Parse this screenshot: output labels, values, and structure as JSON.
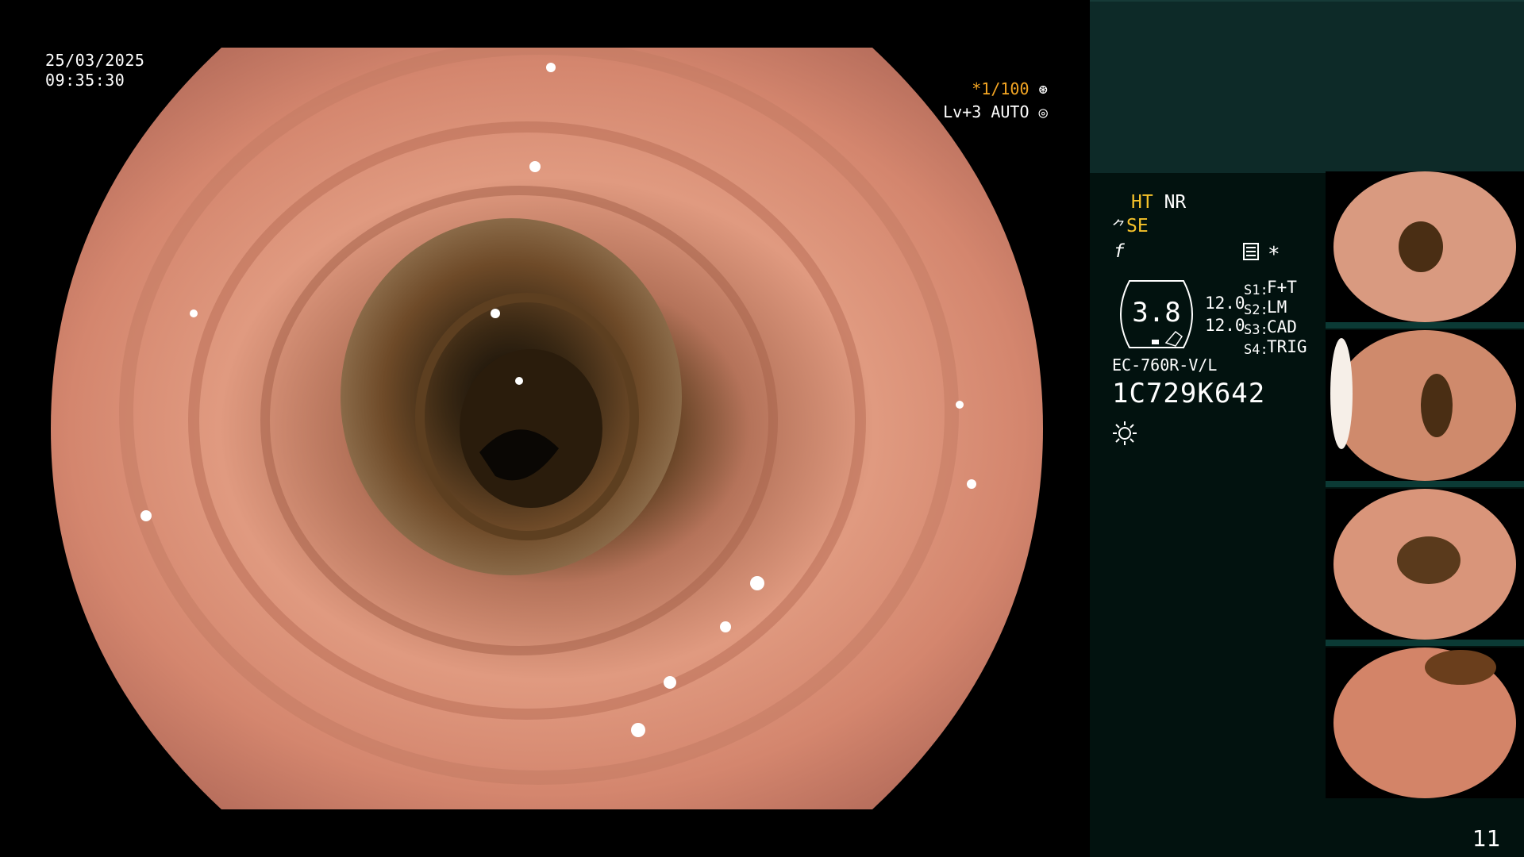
{
  "overlay": {
    "date": "25/03/2025",
    "time": "09:35:30",
    "shutter_speed": "*1/100",
    "shutter_icon": "aperture-icon",
    "level": "Lv+3 AUTO",
    "level_icon": "iris-icon"
  },
  "side": {
    "ht": "HT",
    "nr": "NR",
    "se": "SE",
    "se_icon": "tool-icon",
    "f_icon": "f-icon",
    "memo_icon": "memo-icon",
    "star": "*",
    "gauge_value": "3.8",
    "val_a": "12.0",
    "val_b": "12.0",
    "settings": [
      {
        "label": "S1:",
        "value": "F+T"
      },
      {
        "label": "S2:",
        "value": "LM"
      },
      {
        "label": "S3:",
        "value": "CAD"
      },
      {
        "label": "S4:",
        "value": "TRIG"
      }
    ],
    "model": "EC-760R-V/L",
    "serial": "1C729K642",
    "light_icon": "sun-icon"
  },
  "colors": {
    "accent_yellow": "#f5c12a",
    "accent_orange": "#f5a623",
    "panel_dark": "#02120f",
    "panel_band": "#0d2a28"
  },
  "page_number": "11"
}
